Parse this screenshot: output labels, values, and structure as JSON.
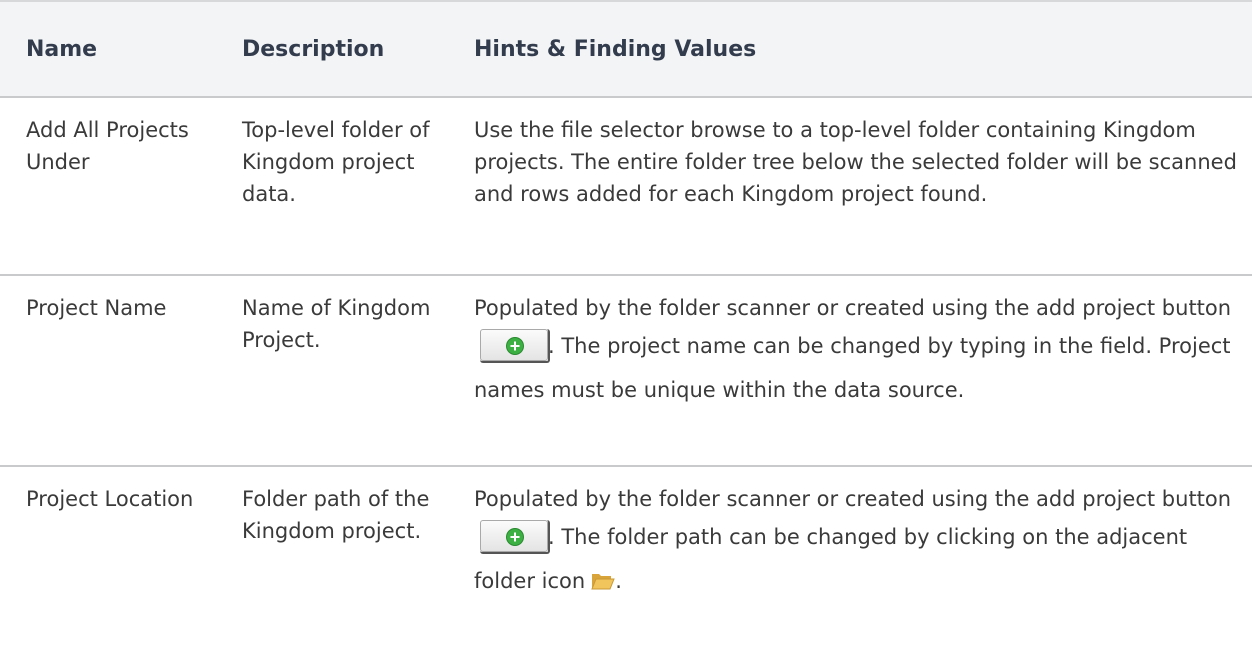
{
  "table": {
    "headers": {
      "name": "Name",
      "description": "Description",
      "hints": "Hints & Finding Values"
    },
    "rows": [
      {
        "name": "Add All Projects Under",
        "description": "Top-level folder of Kingdom project data.",
        "hints": "Use the file selector browse to a top-level folder containing Kingdom projects. The entire folder tree below the selected folder will be scanned and rows added for each Kingdom project found."
      },
      {
        "name": "Project Name",
        "description": "Name of Kingdom Project.",
        "hints_before_button": "Populated by the folder scanner or created using the add project button",
        "hints_after_button": ". The project name can be changed by typing in the field. Project names must be unique within the data source."
      },
      {
        "name": "Project Location",
        "description": "Folder path of the Kingdom project.",
        "hints_before_button": "Populated by the folder scanner or created using the add project button",
        "hints_after_button": ". The folder path can be changed by clicking on the adjacent folder icon",
        "hints_end": "."
      }
    ]
  },
  "icons": {
    "add_button": "add-project-icon",
    "folder": "folder-open-icon"
  },
  "colors": {
    "header_bg": "#f3f4f6",
    "header_text": "#323c4d",
    "add_icon": "#3cb043",
    "folder_icon": "#e8b64a"
  }
}
